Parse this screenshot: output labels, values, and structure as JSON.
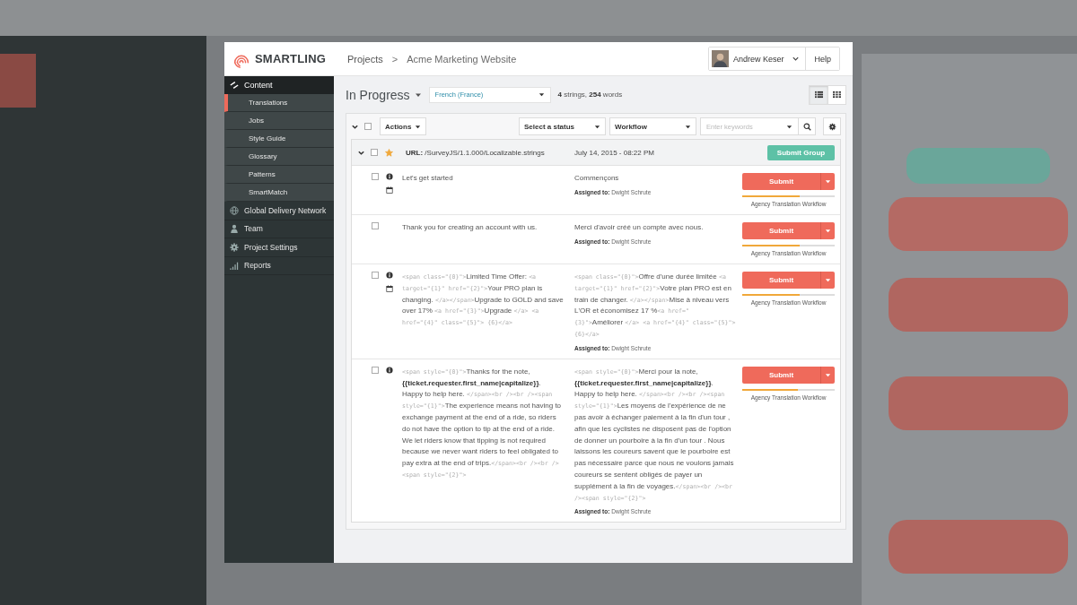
{
  "header": {
    "logo": "SMARTLING",
    "breadcrumb": [
      {
        "label": "Projects"
      },
      {
        "label": ">"
      },
      {
        "label": "Acme Marketing Website"
      }
    ],
    "user": "Andrew Keser",
    "help": "Help"
  },
  "sidebar": {
    "section": {
      "label": "Content",
      "children": [
        {
          "label": "Translations",
          "selected": true
        },
        {
          "label": "Jobs",
          "selected": false
        },
        {
          "label": "Style Guide",
          "selected": false
        },
        {
          "label": "Glossary",
          "selected": false
        },
        {
          "label": "Patterns",
          "selected": false
        },
        {
          "label": "SmartMatch",
          "selected": false
        }
      ]
    },
    "items": [
      {
        "label": "Global Delivery Network",
        "kind": "globe"
      },
      {
        "label": "Team",
        "kind": "person"
      },
      {
        "label": "Project Settings",
        "kind": "gear"
      },
      {
        "label": "Reports",
        "kind": "bars"
      }
    ]
  },
  "page": {
    "title": "In Progress",
    "locale": "French (France)",
    "summary": [
      {
        "kind": "bold",
        "text": "4"
      },
      {
        "kind": "text",
        "text": " strings, "
      },
      {
        "kind": "bold",
        "text": "254"
      },
      {
        "kind": "text",
        "text": " words"
      }
    ],
    "views": [
      {
        "kind": "list",
        "selected": true
      },
      {
        "kind": "grid",
        "selected": false
      }
    ]
  },
  "toolbar": {
    "checked": false,
    "actions": "Actions",
    "status": "Select a status",
    "workflow": "Workflow",
    "search": {
      "placeholder": "Enter keywords"
    }
  },
  "group": {
    "checked": false,
    "starred": true,
    "url_label": "URL:",
    "url": "/SurveyJS/1.1.000/Localizable.strings",
    "date": "July 14, 2015 - 08:22 PM",
    "submit": "Submit Group"
  },
  "rows": [
    {
      "checked": false,
      "info": true,
      "calendar": true,
      "source": [
        {
          "kind": "text",
          "text": "Let's get started"
        }
      ],
      "target": [
        {
          "kind": "text",
          "text": "Commençons"
        }
      ],
      "assigned_label": "Assigned to:",
      "assignee": "Dwight Schrute",
      "submit": "Submit",
      "level": 0.62,
      "workflow": "Agency Translation Workflow"
    },
    {
      "checked": false,
      "info": false,
      "calendar": false,
      "source": [
        {
          "kind": "text",
          "text": "Thank you for creating an account with us."
        }
      ],
      "target": [
        {
          "kind": "text",
          "text": "Merci d'avoir créé un compte avec nous."
        }
      ],
      "assigned_label": "Assigned to:",
      "assignee": "Dwight Schrute",
      "submit": "Submit",
      "level": 0.62,
      "workflow": "Agency Translation Workflow"
    },
    {
      "checked": false,
      "info": true,
      "calendar": true,
      "source": [
        {
          "kind": "code",
          "text": "<span class=\"{0}\">"
        },
        {
          "kind": "text",
          "text": "Limited Time Offer: "
        },
        {
          "kind": "code",
          "text": "<a target=\"{1}\" href=\"{2}\">"
        },
        {
          "kind": "text",
          "text": "Your PRO plan is changing. "
        },
        {
          "kind": "code",
          "text": "</a></span>"
        },
        {
          "kind": "text",
          "text": "Upgrade to GOLD and save over 17% "
        },
        {
          "kind": "code",
          "text": "<a href=\"{3}\">"
        },
        {
          "kind": "text",
          "text": "Upgrade "
        },
        {
          "kind": "code",
          "text": "</a> <a href=\"{4}\" class=\"{5}\"> {6}</a>"
        }
      ],
      "target": [
        {
          "kind": "code",
          "text": "<span class=\"{0}\">"
        },
        {
          "kind": "text",
          "text": "Offre d'une durée limitée "
        },
        {
          "kind": "code",
          "text": "<a target=\"{1}\" href=\"{2}\">"
        },
        {
          "kind": "text",
          "text": "Votre plan PRO est en train de changer. "
        },
        {
          "kind": "code",
          "text": "</a></span>"
        },
        {
          "kind": "text",
          "text": "Mise à niveau vers L'OR et économisez 17 %"
        },
        {
          "kind": "code",
          "text": "<a href=\"{3}\">"
        },
        {
          "kind": "text",
          "text": "Améliorer "
        },
        {
          "kind": "code",
          "text": "</a> <a href=\"{4}\" class=\"{5}\"> {6}</a>"
        }
      ],
      "assigned_label": "Assigned to:",
      "assignee": "Dwight Schrute",
      "submit": "Submit",
      "level": 0.62,
      "workflow": "Agency Translation Workflow"
    },
    {
      "checked": false,
      "info": true,
      "calendar": false,
      "source": [
        {
          "kind": "code",
          "text": "<span style=\"{0}\">"
        },
        {
          "kind": "text",
          "text": "Thanks for the note, "
        },
        {
          "kind": "bold",
          "text": "{{ticket.requester.first_name|capitalize}}"
        },
        {
          "kind": "text",
          "text": ". Happy to help here. "
        },
        {
          "kind": "code",
          "text": "</span><br /><br /><span style=\"{1}\">"
        },
        {
          "kind": "text",
          "text": "The experience means not having to exchange payment at the end of a ride, so riders do not have the option to tip at the end of a ride. We let riders know that tipping is not required because we never want riders to feel obligated to pay extra at the end of trips."
        },
        {
          "kind": "code",
          "text": "</span><br /><br /><span style=\"{2}\">"
        }
      ],
      "target": [
        {
          "kind": "code",
          "text": "<span style=\"{0}\">"
        },
        {
          "kind": "text",
          "text": "Merci pour la note, "
        },
        {
          "kind": "bold",
          "text": "{{ticket.requester.first_name|capitalize}}"
        },
        {
          "kind": "text",
          "text": ". Happy to help here. "
        },
        {
          "kind": "code",
          "text": "</span><br /><br /><span style=\"{1}\">"
        },
        {
          "kind": "text",
          "text": "Les moyens de l'expérience de ne pas avoir à échanger paiement à la fin d'un tour , afin que les cyclistes ne disposent pas de l'option de donner un pourboire à la fin d'un tour . Nous laissons les coureurs savent que le pourboire est pas nécessaire parce que nous ne voulons jamais coureurs se sentent obligés de payer un supplément à la fin de voyages."
        },
        {
          "kind": "code",
          "text": "</span><br /><br /><span style=\"{2}\">"
        }
      ],
      "assigned_label": "Assigned to:",
      "assignee": "Dwight Schrute",
      "submit": "Submit",
      "level": 0.6,
      "workflow": "Agency Translation Workflow"
    }
  ]
}
